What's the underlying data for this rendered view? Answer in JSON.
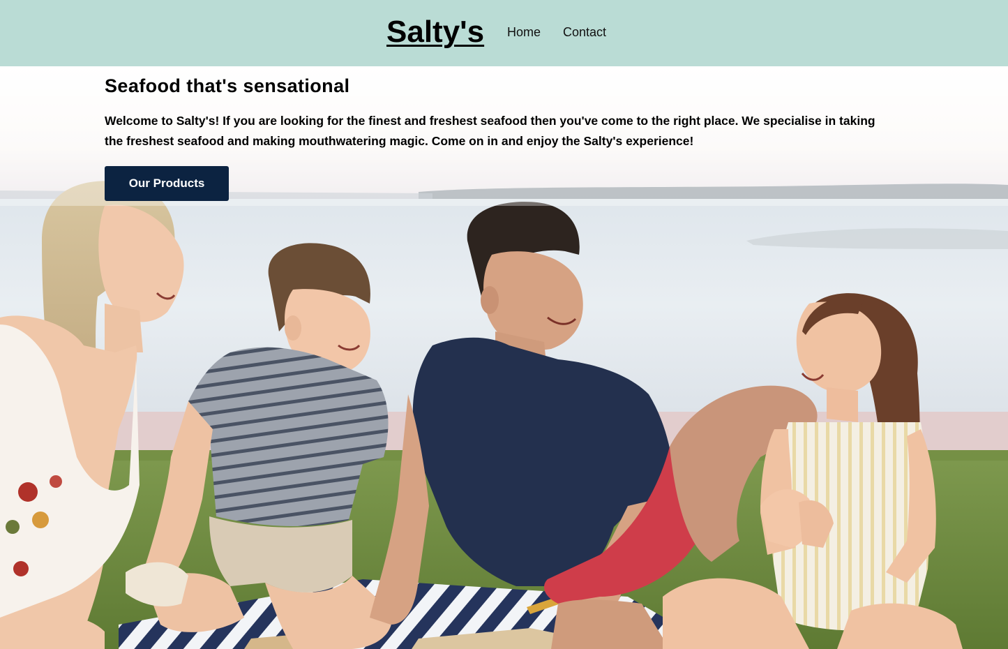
{
  "header": {
    "brand": "Salty's",
    "nav": [
      {
        "label": "Home"
      },
      {
        "label": "Contact"
      }
    ]
  },
  "hero": {
    "title": "Seafood that's sensational",
    "text": "Welcome to Salty's! If you are looking for the finest and freshest seafood then you've come to the right place. We specialise in taking the freshest seafood and making mouthwatering magic. Come on in and enjoy the Salty's experience!",
    "cta_label": "Our Products",
    "image_subject": "family-picnic-by-the-water"
  },
  "colors": {
    "header_bg": "#badcd5",
    "cta_bg": "#0c2341",
    "cta_text": "#ffffff",
    "text": "#000000"
  }
}
